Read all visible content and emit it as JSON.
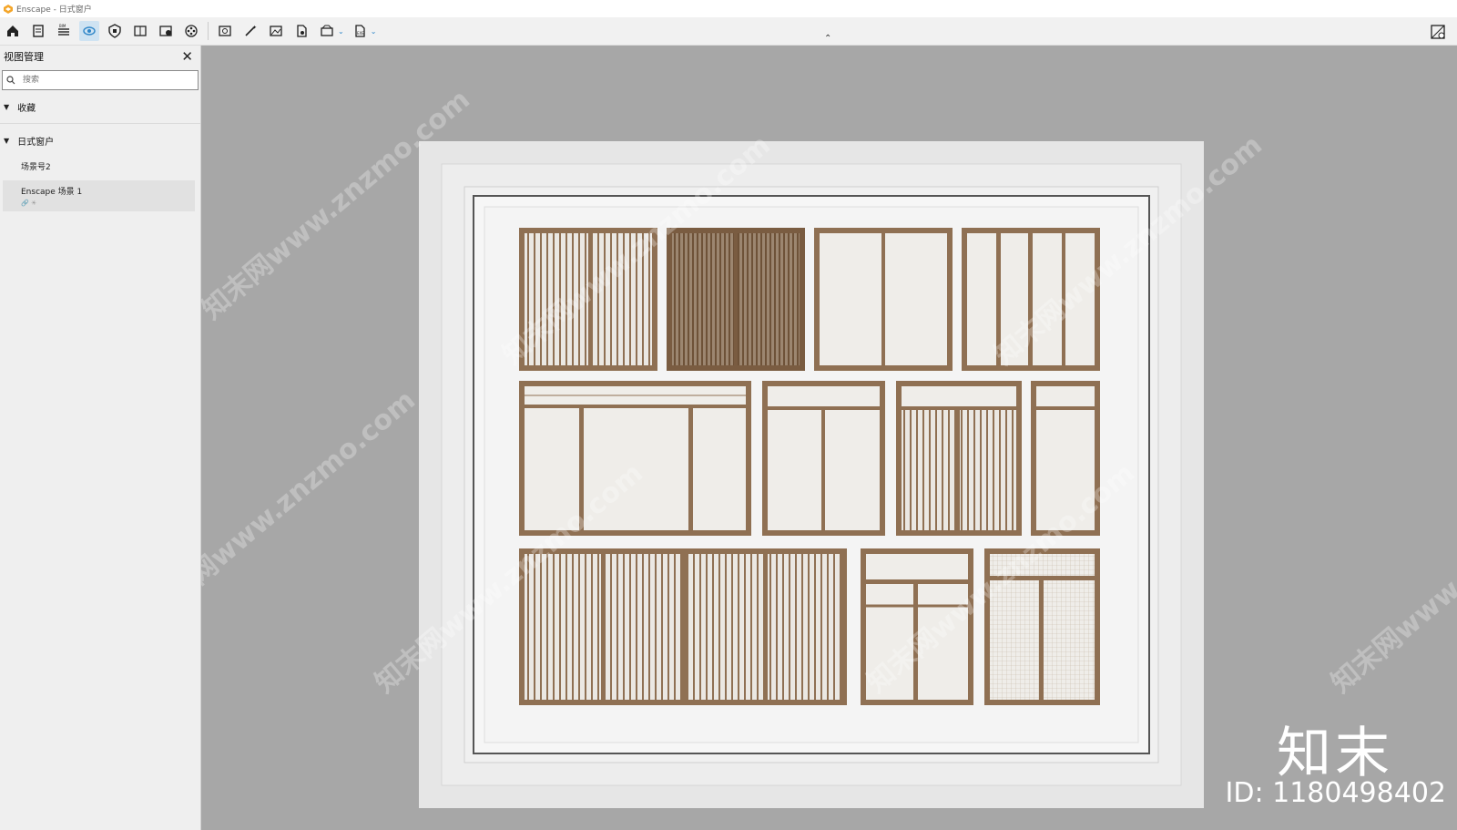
{
  "window": {
    "title": "Enscape - 日式窗户"
  },
  "toolbar": {
    "buttons": [
      "home-icon",
      "document-icon",
      "bim-icon",
      "view-manager-icon",
      "shield-icon",
      "book-icon",
      "asset-library-icon",
      "film-reel-icon",
      "screenshot-icon",
      "magic-wand-icon",
      "image-icon",
      "export-file-icon",
      "panorama-icon",
      "exe-export-icon",
      "settings-icon"
    ],
    "active": "view-manager-icon",
    "accent_color": "#2f86c8"
  },
  "sidebar": {
    "title": "视图管理",
    "search_placeholder": "搜索",
    "groups": [
      {
        "label": "收藏"
      },
      {
        "label": "日式窗户",
        "items": [
          {
            "label": "场景号2"
          },
          {
            "label": "Enscape 场景 1"
          }
        ]
      }
    ]
  },
  "watermark": {
    "text": "知末网www.znzmo.com",
    "brand": "知末",
    "id": "ID: 1180498402"
  }
}
